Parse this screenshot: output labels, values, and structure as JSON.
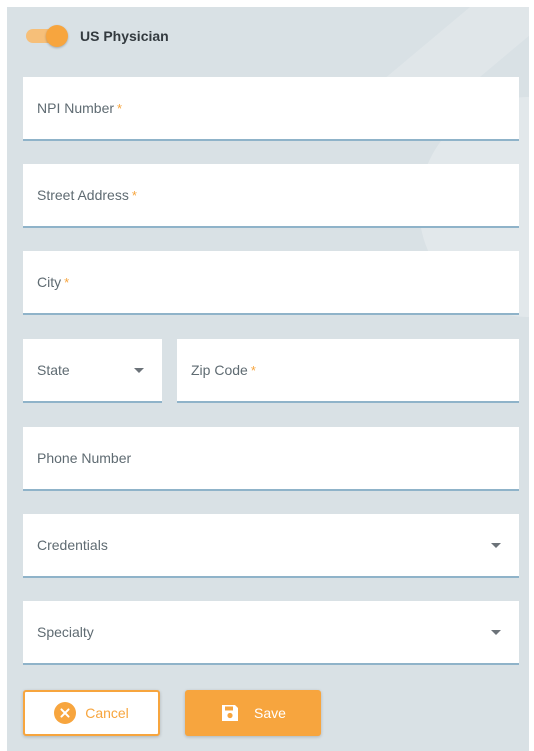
{
  "toggle": {
    "label": "US Physician",
    "on": true
  },
  "form": {
    "npi": {
      "label": "NPI Number",
      "required_mark": "*"
    },
    "street": {
      "label": "Street Address",
      "required_mark": "*"
    },
    "city": {
      "label": "City",
      "required_mark": "*"
    },
    "state": {
      "label": "State"
    },
    "zip": {
      "label": "Zip Code",
      "required_mark": "*"
    },
    "phone": {
      "label": "Phone Number"
    },
    "credentials": {
      "label": "Credentials"
    },
    "specialty": {
      "label": "Specialty"
    }
  },
  "actions": {
    "cancel_label": "Cancel",
    "save_label": "Save"
  },
  "colors": {
    "accent": "#f7a53e",
    "panel_bg": "#d9e1e5",
    "field_underline": "#8fb3c9"
  },
  "icons": {
    "cancel": "cancel-circle-icon",
    "save": "floppy-disk-icon",
    "dropdown": "caret-down-icon"
  }
}
